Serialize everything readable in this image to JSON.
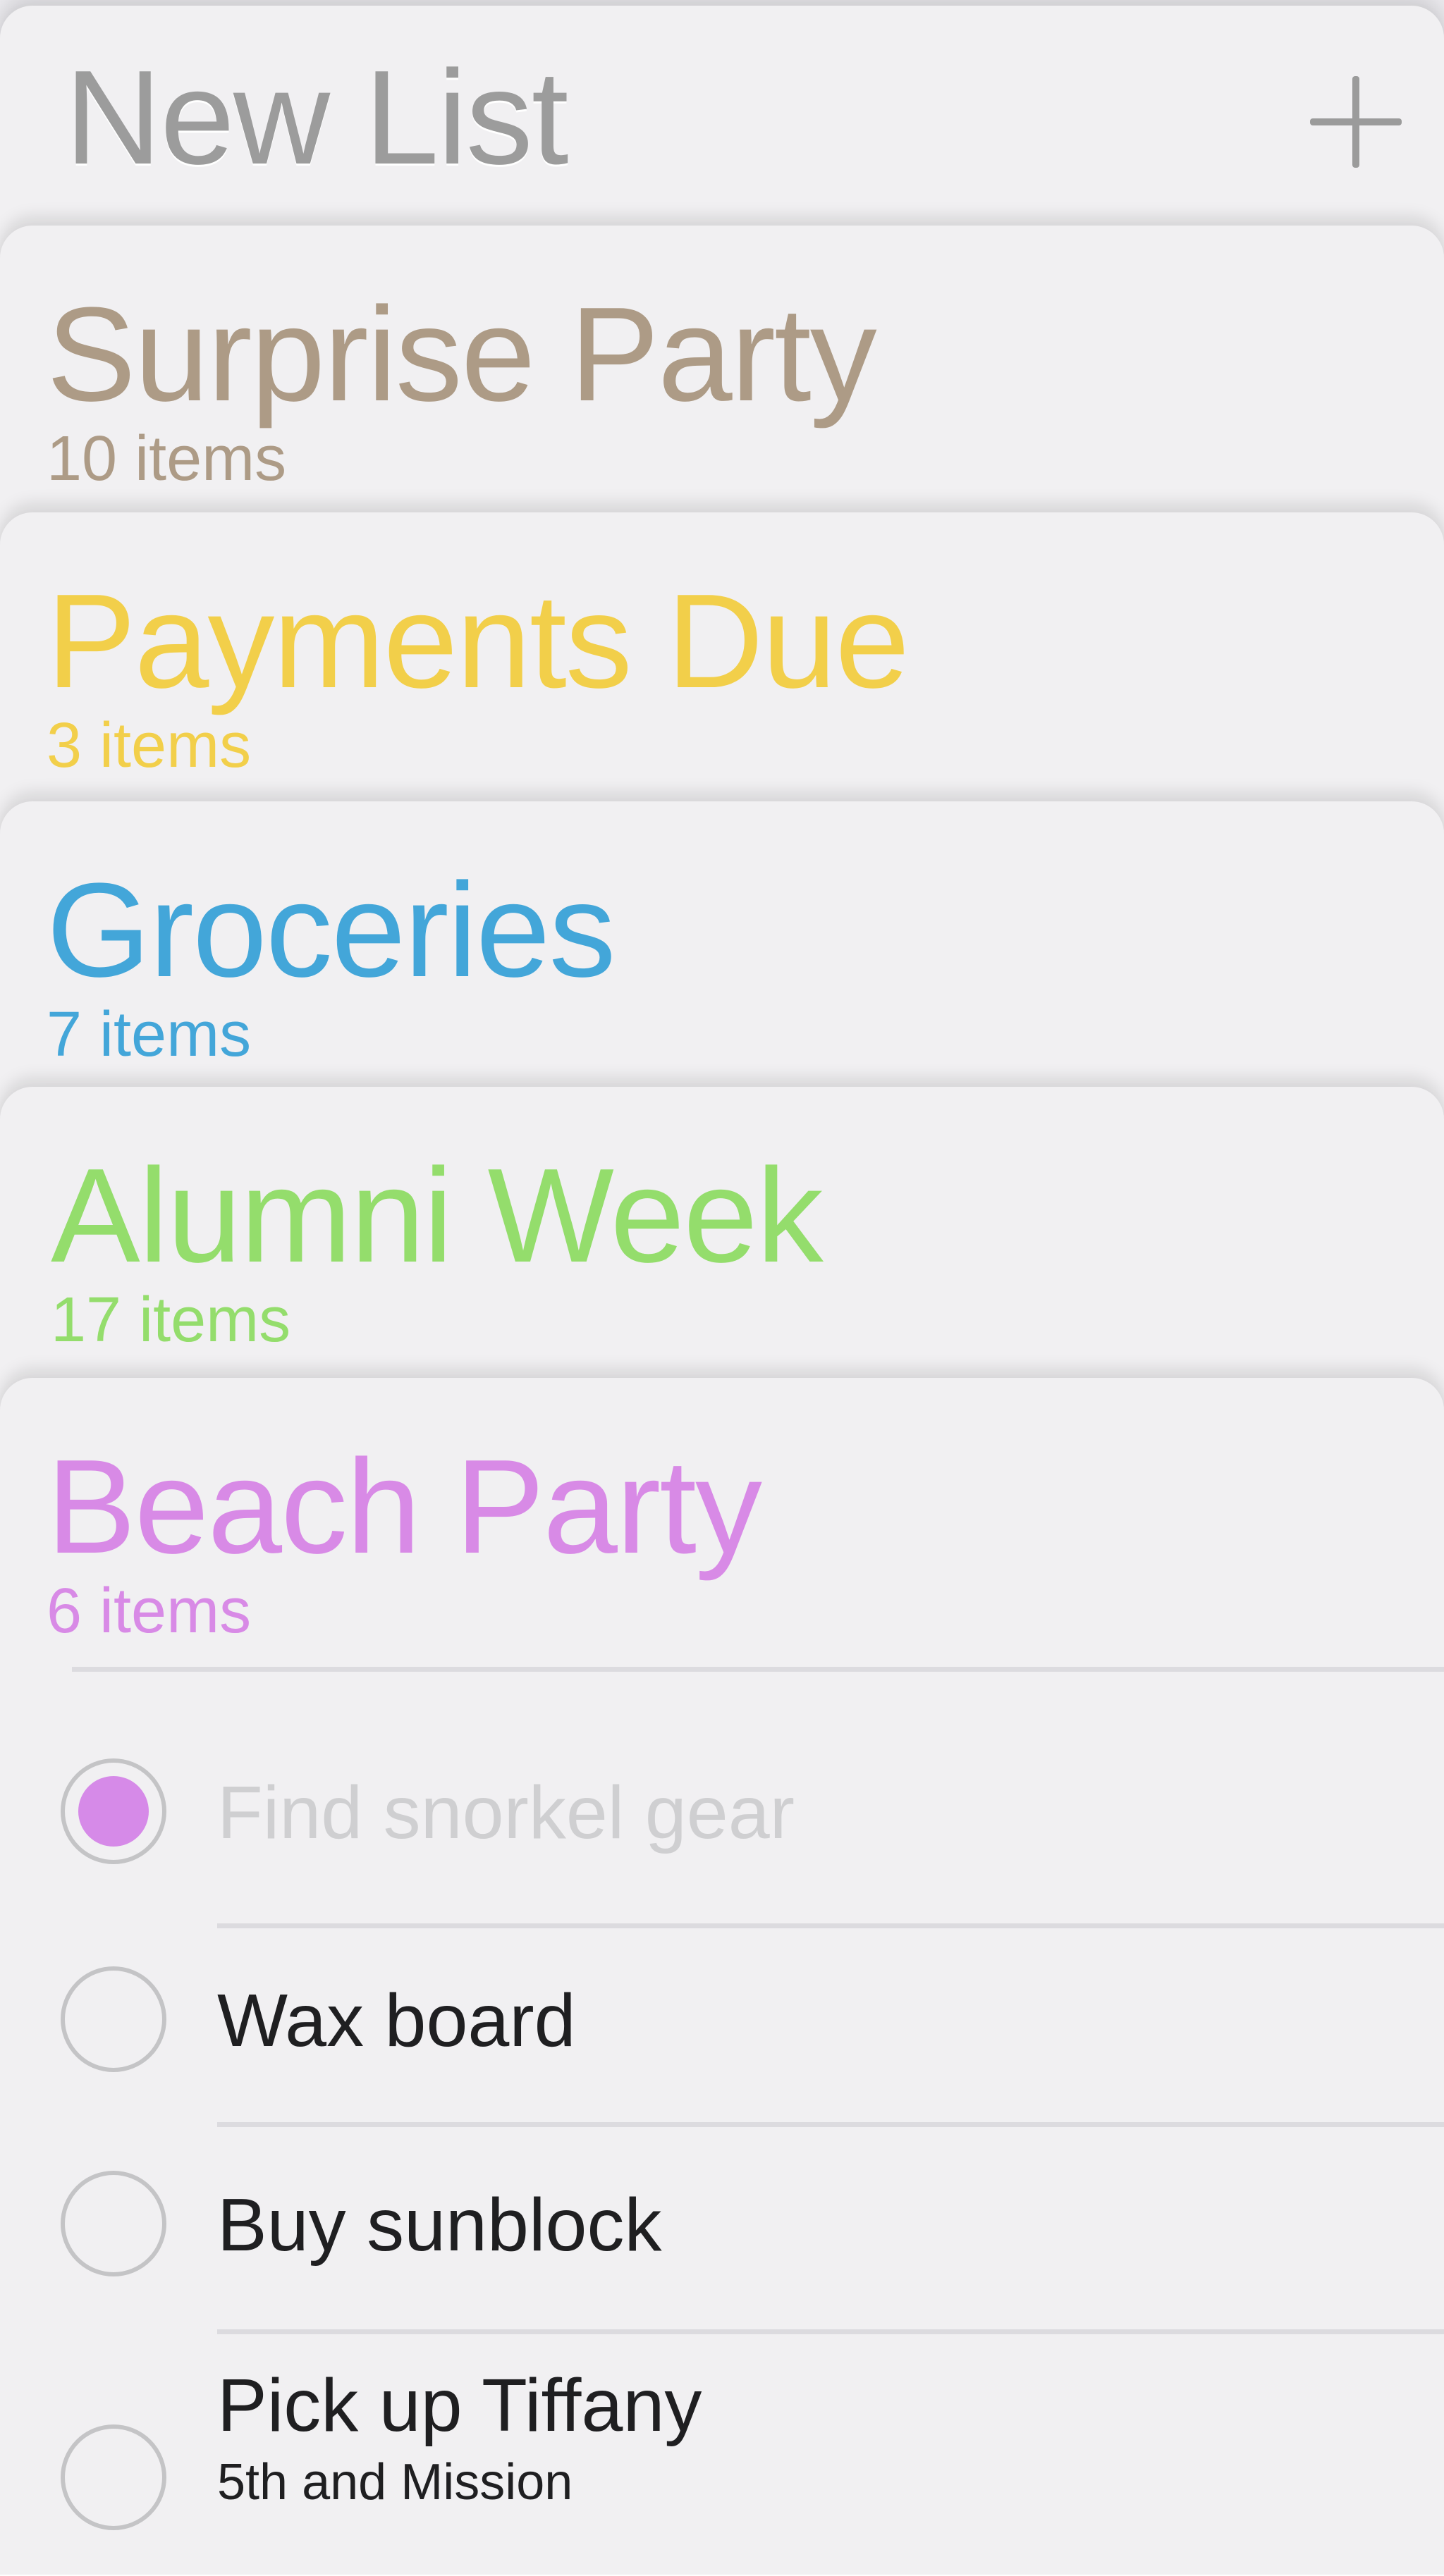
{
  "header": {
    "title": "New List",
    "add_icon": "plus-icon"
  },
  "lists": [
    {
      "title": "Surprise Party",
      "count": "10 items",
      "color": "#ad9b86"
    },
    {
      "title": "Payments Due",
      "count": "3 items",
      "color": "#f2cf4a"
    },
    {
      "title": "Groceries",
      "count": "7 items",
      "color": "#43a6d9"
    },
    {
      "title": "Alumni Week",
      "count": "17 items",
      "color": "#94dd6c"
    },
    {
      "title": "Beach Party",
      "count": "6 items",
      "color": "#d88ae6"
    }
  ],
  "tasks": [
    {
      "label": "Find snorkel gear",
      "done": true
    },
    {
      "label": "Wax board",
      "done": false
    },
    {
      "label": "Buy sunblock",
      "done": false
    },
    {
      "label": "Pick up Tiffany",
      "sub": "5th and Mission",
      "done": false
    }
  ],
  "colors": {
    "background": "#f1f0f2",
    "checked_fill": "#d68ae8",
    "header_text": "#9c9c9c"
  }
}
